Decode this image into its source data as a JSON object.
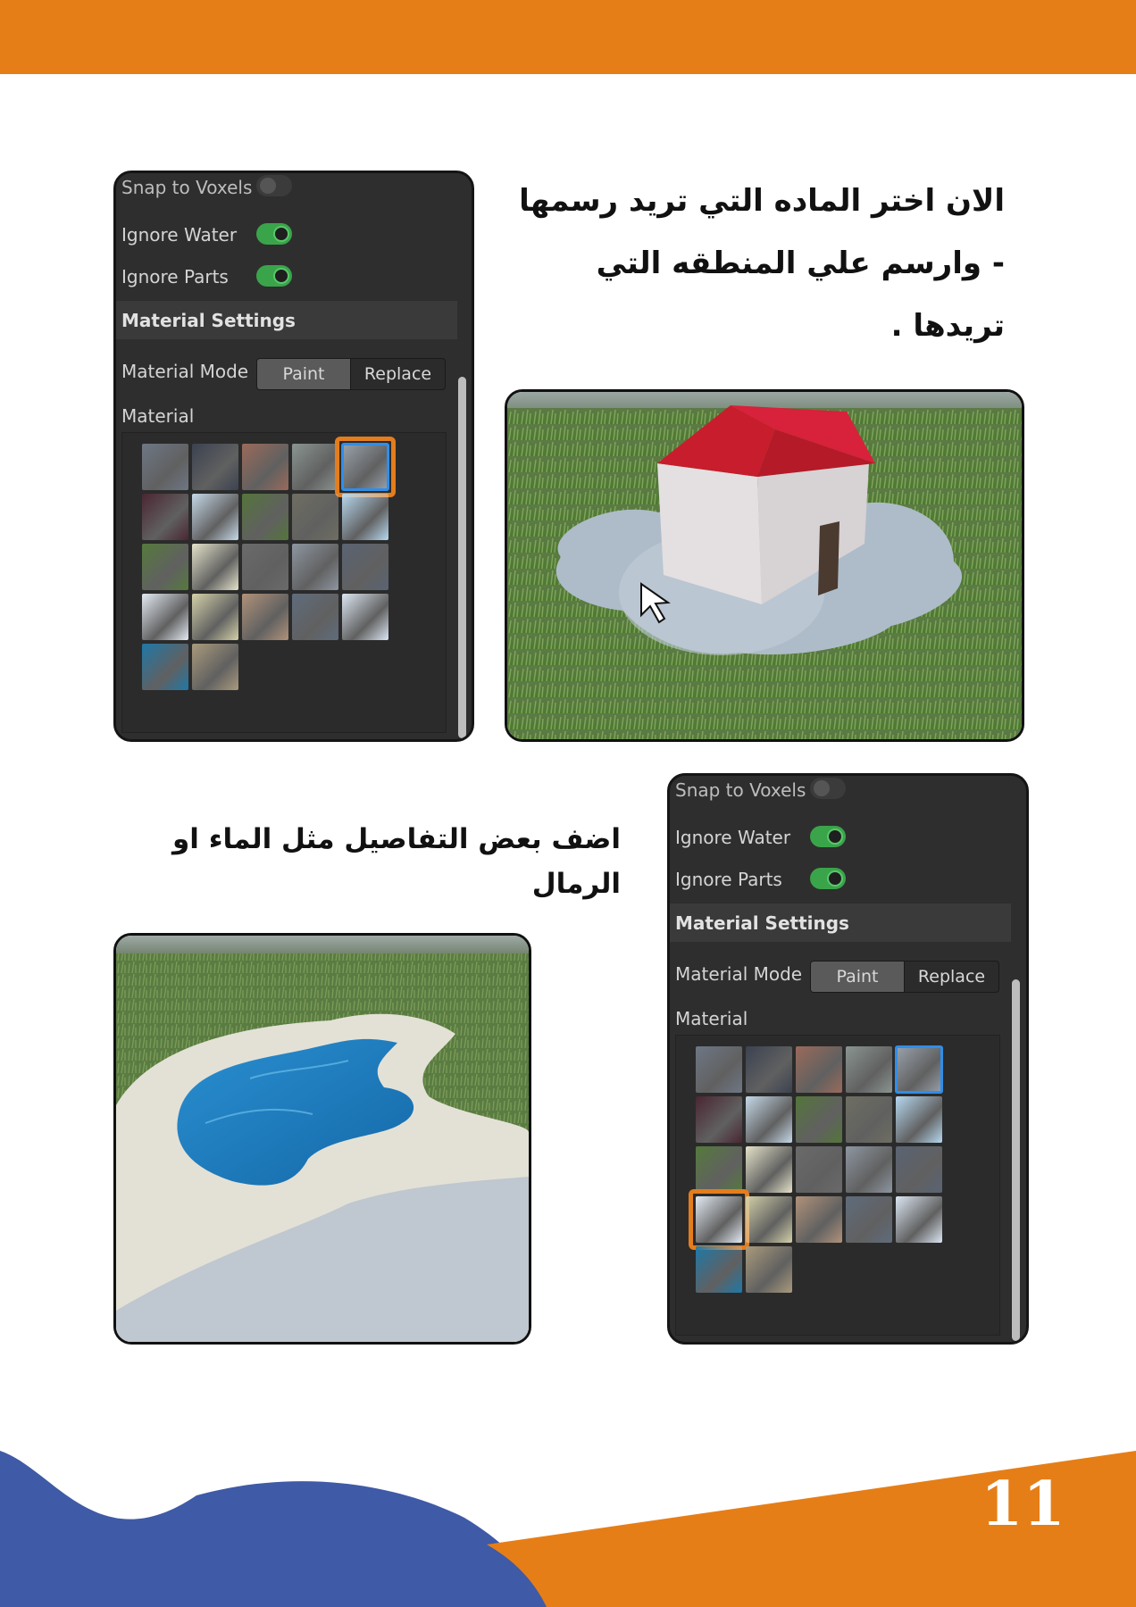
{
  "page": {
    "number": "11",
    "colors": {
      "orange": "#e67e17",
      "blue": "#3f5aa6"
    }
  },
  "instruction_top": "الان اختر الماده التي تريد رسمها - وارسم علي المنطقه التي تريدها .",
  "instruction_bottom": "اضف بعض التفاصيل مثل الماء او الرمال",
  "panel_top": {
    "snap_label": "Snap to Voxels",
    "water_label": "Ignore Water",
    "parts_label": "Ignore Parts",
    "section_title": "Material Settings",
    "mode_label": "Material Mode",
    "paint_label": "Paint",
    "replace_label": "Replace",
    "material_label": "Material",
    "selected_material_index": 4
  },
  "panel_bottom": {
    "snap_label": "Snap to Voxels",
    "water_label": "Ignore Water",
    "parts_label": "Ignore Parts",
    "section_title": "Material Settings",
    "mode_label": "Material Mode",
    "paint_label": "Paint",
    "replace_label": "Replace",
    "material_label": "Material",
    "selected_material_index": 15
  },
  "materials": [
    {
      "name": "asphalt",
      "color": "#6e7785"
    },
    {
      "name": "basalt",
      "color": "#3b4250"
    },
    {
      "name": "brick",
      "color": "#9a6a5a"
    },
    {
      "name": "cobblestone",
      "color": "#8a9590"
    },
    {
      "name": "concrete",
      "color": "#9aa3ad"
    },
    {
      "name": "cracked-lava",
      "color": "#4a2632"
    },
    {
      "name": "glacier",
      "color": "#c5d8e8"
    },
    {
      "name": "grass",
      "color": "#54753a"
    },
    {
      "name": "ground",
      "color": "#6e6e62"
    },
    {
      "name": "ice",
      "color": "#b6d8f0"
    },
    {
      "name": "leafy-grass",
      "color": "#557a3c"
    },
    {
      "name": "limestone",
      "color": "#e4e2c9"
    },
    {
      "name": "mud",
      "color": "#6a6a6a"
    },
    {
      "name": "pavement",
      "color": "#8d96a0"
    },
    {
      "name": "rock",
      "color": "#5a6473"
    },
    {
      "name": "salt",
      "color": "#e3eaf3"
    },
    {
      "name": "sand",
      "color": "#d3d0a8"
    },
    {
      "name": "sandstone",
      "color": "#b0927a"
    },
    {
      "name": "slate",
      "color": "#5f6c7c"
    },
    {
      "name": "snow",
      "color": "#dbe6f2"
    },
    {
      "name": "water",
      "color": "#1f78a8"
    },
    {
      "name": "wood-planks",
      "color": "#a99a7c"
    }
  ]
}
